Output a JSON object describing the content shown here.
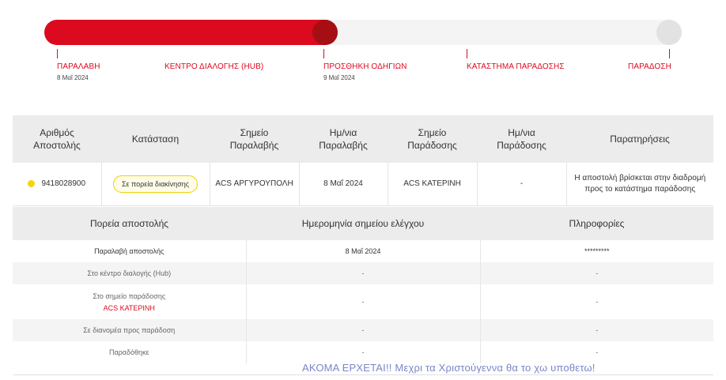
{
  "progress": {
    "fill_fraction": 0.46,
    "colors": {
      "fill": "#dc0a1e",
      "knob": "#a50f14",
      "track": "#f4f4f4",
      "end": "#e2e2e2"
    },
    "steps": [
      {
        "label": "ΠΑΡΑΛΑΒΗ",
        "date": "8 Μαΐ 2024"
      },
      {
        "label": "ΚΕΝΤΡΟ ΔΙΑΛΟΓΗΣ (HUB)",
        "date": ""
      },
      {
        "label": "ΠΡΟΣΘΗΚΗ ΟΔΗΓΙΩΝ",
        "date": "9 Μαΐ 2024"
      },
      {
        "label": "ΚΑΤΑΣΤΗΜΑ ΠΑΡΑΔΟΣΗΣ",
        "date": ""
      },
      {
        "label": "ΠΑΡΑΔΟΣΗ",
        "date": ""
      }
    ]
  },
  "shipment_table": {
    "headers": {
      "number_l1": "Αριθμός",
      "number_l2": "Αποστολής",
      "status": "Κατάσταση",
      "pickup_point_l1": "Σημείο",
      "pickup_point_l2": "Παραλαβής",
      "pickup_date_l1": "Ημ/νια",
      "pickup_date_l2": "Παραλαβής",
      "delivery_point_l1": "Σημείο",
      "delivery_point_l2": "Παράδοσης",
      "delivery_date_l1": "Ημ/νια",
      "delivery_date_l2": "Παράδοσης",
      "notes": "Παρατηρήσεις"
    },
    "row": {
      "number": "9418028900",
      "status": "Σε πορεία διακίνησης",
      "pickup_point": "ACS ΑΡΓΥΡΟΥΠΟΛΗ",
      "pickup_date": "8 Μαΐ 2024",
      "delivery_point": "ACS ΚΑΤΕΡΙΝΗ",
      "delivery_date": "-",
      "notes_l1": "Η αποστολή βρίσκεται στην διαδρομή",
      "notes_l2": "προς το κατάστημα παράδοσης"
    }
  },
  "history_table": {
    "headers": {
      "route": "Πορεία αποστολής",
      "checkpoint_date": "Ημερομηνία σημείου ελέγχου",
      "info": "Πληροφορίες"
    },
    "rows": [
      {
        "route": "Παραλαβή αποστολής",
        "sub": "",
        "date": "8 Μαΐ 2024",
        "info": "*********"
      },
      {
        "route": "Στο κέντρο διαλογής (Hub)",
        "sub": "",
        "date": "-",
        "info": "-"
      },
      {
        "route": "Στο σημείο παράδοσης",
        "sub": "ACS ΚΑΤΕΡΙΝΗ",
        "date": "-",
        "info": "-"
      },
      {
        "route": "Σε διανομέα προς παράδοση",
        "sub": "",
        "date": "-",
        "info": "-"
      },
      {
        "route": "Παραδόθηκε",
        "sub": "",
        "date": "-",
        "info": "-"
      }
    ]
  },
  "overlay_text": "ΑΚΟΜΑ ΕΡΧΕΤΑΙ!! Μεχρι τα Χριστούγεννα θα το χω υποθετω!"
}
